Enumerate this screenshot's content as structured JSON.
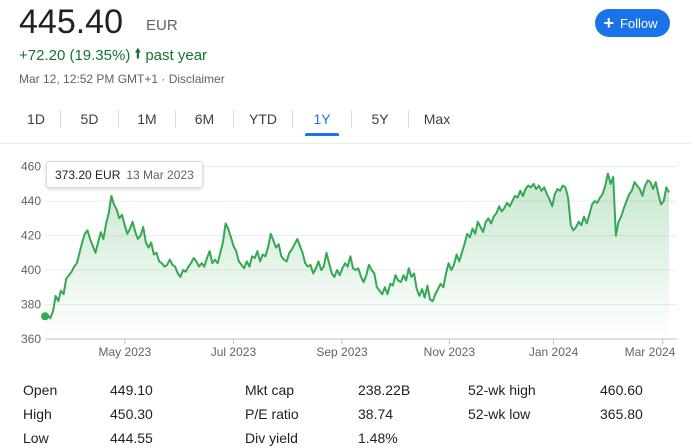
{
  "quote": {
    "price": "445.40",
    "currency": "EUR",
    "change": "+72.20 (19.35%)",
    "change_arrow": "arrow-up-icon",
    "period": "past year",
    "timestamp": "Mar 12, 12:52 PM GMT+1 · Disclaimer"
  },
  "follow_button": {
    "label": "Follow",
    "icon": "plus-icon"
  },
  "ranges": [
    "1D",
    "5D",
    "1M",
    "6M",
    "YTD",
    "1Y",
    "5Y",
    "Max"
  ],
  "active_range": "1Y",
  "tooltip": {
    "price": "373.20 EUR",
    "date": "13 Mar 2023"
  },
  "colors": {
    "line": "#34a853",
    "accent": "#1a73e8",
    "positive": "#137333"
  },
  "chart_data": {
    "type": "area",
    "ylim": [
      360,
      465
    ],
    "yticks": [
      "360",
      "380",
      "400",
      "420",
      "440",
      "460"
    ],
    "xtick_labels": [
      "May 2023",
      "Jul 2023",
      "Sep 2023",
      "Nov 2023",
      "Jan 2024",
      "Mar 2024"
    ],
    "series": [
      {
        "values": [
          373.2,
          374,
          372,
          376,
          385,
          382,
          388,
          386,
          395,
          397,
          399,
          402,
          404,
          410,
          416,
          421,
          423,
          418,
          414,
          410,
          416,
          422,
          418,
          427,
          433,
          443,
          438,
          435,
          430,
          432,
          426,
          421,
          424,
          428,
          422,
          418,
          420,
          425,
          416,
          413,
          416,
          409,
          410,
          405,
          404,
          402,
          403,
          406,
          403,
          402,
          398,
          396,
          400,
          399,
          402,
          404,
          407,
          405,
          402,
          404,
          402,
          407,
          411,
          404,
          406,
          404,
          410,
          416,
          427,
          424,
          419,
          414,
          411,
          405,
          403,
          401,
          405,
          402,
          408,
          407,
          411,
          405,
          409,
          408,
          413,
          421,
          417,
          413,
          415,
          408,
          406,
          405,
          410,
          412,
          415,
          418,
          414,
          410,
          404,
          402,
          403,
          398,
          401,
          405,
          400,
          402,
          410,
          404,
          398,
          396,
          400,
          397,
          401,
          404,
          402,
          408,
          401,
          400,
          401,
          396,
          393,
          397,
          403,
          400,
          398,
          390,
          388,
          386,
          390,
          386,
          392,
          391,
          397,
          394,
          393,
          397,
          394,
          401,
          396,
          398,
          389,
          385,
          389,
          384,
          391,
          383,
          382,
          386,
          389,
          392,
          390,
          398,
          404,
          400,
          403,
          409,
          405,
          410,
          415,
          421,
          419,
          424,
          421,
          428,
          425,
          422,
          428,
          430,
          427,
          431,
          433,
          437,
          434,
          436,
          439,
          437,
          440,
          443,
          442,
          446,
          443,
          447,
          449,
          448,
          450,
          447,
          449,
          446,
          448,
          444,
          441,
          437,
          444,
          447,
          446,
          449,
          448,
          442,
          426,
          423,
          425,
          428,
          426,
          431,
          427,
          432,
          438,
          440,
          439,
          442,
          444,
          449,
          456,
          450,
          454,
          420,
          428,
          431,
          436,
          440,
          444,
          446,
          451,
          449,
          447,
          443,
          449,
          452,
          451,
          447,
          451,
          444,
          438,
          440,
          448,
          445
        ]
      }
    ]
  },
  "stats": {
    "col1": [
      {
        "label": "Open",
        "value": "449.10"
      },
      {
        "label": "High",
        "value": "450.30"
      },
      {
        "label": "Low",
        "value": "444.55"
      }
    ],
    "col2": [
      {
        "label": "Mkt cap",
        "value": "238.22B"
      },
      {
        "label": "P/E ratio",
        "value": "38.74"
      },
      {
        "label": "Div yield",
        "value": "1.48%"
      }
    ],
    "col3": [
      {
        "label": "52-wk high",
        "value": "460.60"
      },
      {
        "label": "52-wk low",
        "value": "365.80"
      }
    ]
  }
}
